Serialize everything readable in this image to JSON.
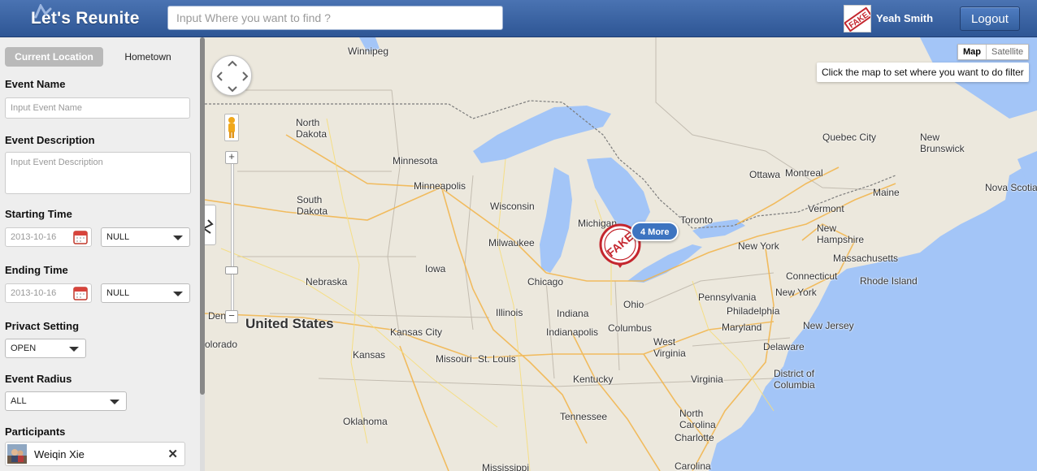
{
  "header": {
    "logo": "Let's Reunite",
    "search_placeholder": "Input Where you want to find ?",
    "user_name": "Yeah Smith",
    "logout_label": "Logout"
  },
  "sidebar": {
    "tabs": [
      "Current Location",
      "Hometown"
    ],
    "event_name": {
      "label": "Event Name",
      "placeholder": "Input Event Name"
    },
    "event_description": {
      "label": "Event Description",
      "placeholder": "Input Event Description"
    },
    "starting_time": {
      "label": "Starting Time",
      "date": "2013-10-16",
      "time": "NULL"
    },
    "ending_time": {
      "label": "Ending Time",
      "date": "2013-10-16",
      "time": "NULL"
    },
    "privacy_setting": {
      "label": "Privact Setting",
      "value": "OPEN"
    },
    "event_radius": {
      "label": "Event Radius",
      "value": "ALL"
    },
    "participants": {
      "label": "Participants",
      "items": [
        {
          "name": "Weiqin Xie"
        }
      ]
    }
  },
  "map": {
    "type_toggle": [
      "Map",
      "Satellite"
    ],
    "hint": "Click the map to set where you want to do filter",
    "cluster_label": "4 More",
    "stamp_text": "FAKE",
    "labels": [
      "Winnipeg",
      "North Dakota",
      "Minnesota",
      "Minneapolis",
      "South Dakota",
      "Wisconsin",
      "Milwaukee",
      "Michigan",
      "Iowa",
      "Chicago",
      "Nebraska",
      "United States",
      "Illinois",
      "Indiana",
      "Indianapolis",
      "Ohio",
      "Columbus",
      "Kansas City",
      "Kansas",
      "Missouri",
      "St. Louis",
      "Denver",
      "Colorado",
      "Kentucky",
      "West Virginia",
      "Virginia",
      "Oklahoma",
      "Tennessee",
      "Mississippi",
      "North Carolina",
      "Charlotte",
      "Carolina",
      "Toronto",
      "Ottawa",
      "Montreal",
      "Quebec City",
      "New Brunswick",
      "Nova Scotia",
      "Maine",
      "Vermont",
      "New Hampshire",
      "Massachusetts",
      "Connecticut",
      "Rhode Island",
      "New York",
      "Pennsylvania",
      "Philadelphia",
      "Maryland",
      "New Jersey",
      "Delaware",
      "District of Columbia"
    ]
  }
}
